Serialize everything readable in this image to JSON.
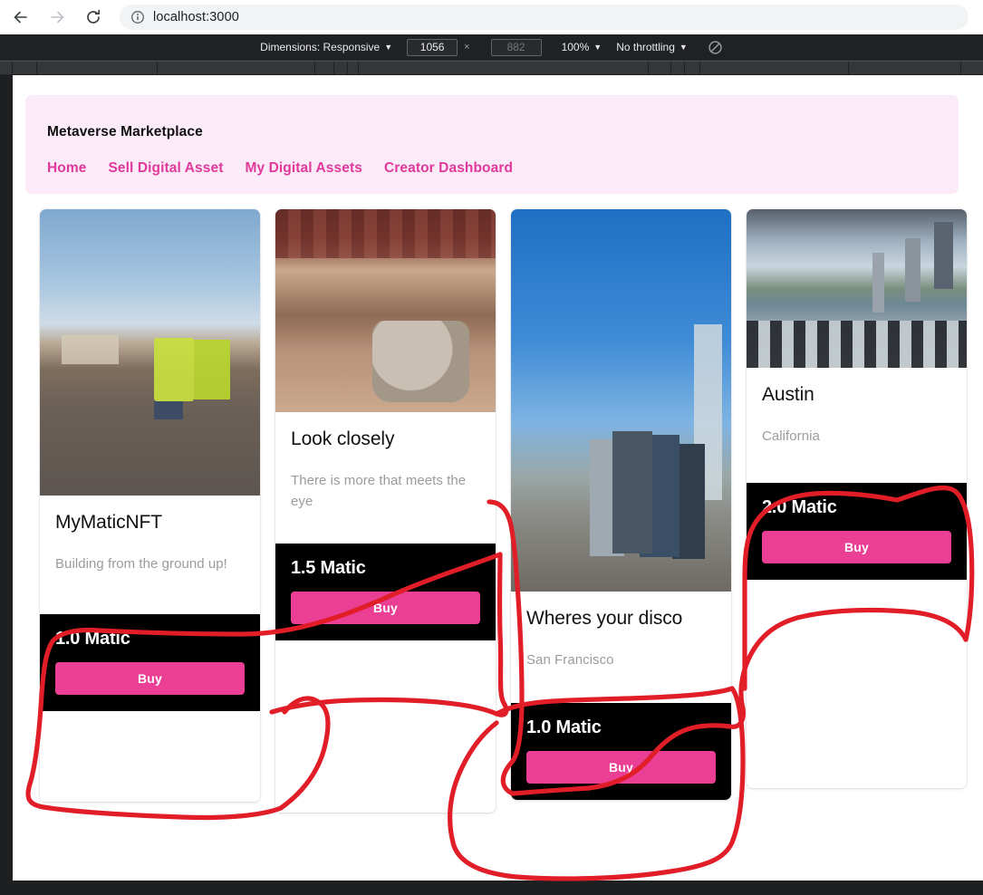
{
  "browser": {
    "back_icon": "back-arrow-icon",
    "forward_icon": "forward-arrow-icon",
    "reload_icon": "reload-icon",
    "site_info_icon": "info-circle-icon",
    "url": "localhost:3000"
  },
  "devtools": {
    "dimensions_label": "Dimensions: Responsive",
    "width_value": "1056",
    "height_placeholder": "882",
    "height_value": "",
    "multiply_symbol": "×",
    "zoom_label": "100%",
    "throttling_label": "No throttling",
    "rotate_icon": "no-throttle-slash-icon",
    "caret": "▼"
  },
  "header": {
    "brand": "Metaverse Marketplace",
    "nav": [
      {
        "label": "Home"
      },
      {
        "label": "Sell Digital Asset"
      },
      {
        "label": "My Digital Assets"
      },
      {
        "label": "Creator Dashboard"
      }
    ]
  },
  "cards": [
    {
      "title": "MyMaticNFT",
      "description": "Building from the ground up!",
      "price": "1.0 Matic",
      "buy_label": "Buy",
      "image_name": "construction-site-photo"
    },
    {
      "title": "Look closely",
      "description": "There is more that meets the eye",
      "price": "1.5 Matic",
      "buy_label": "Buy",
      "image_name": "vintage-diner-car-painting"
    },
    {
      "title": "Wheres your disco",
      "description": "San Francisco",
      "price": "1.0 Matic",
      "buy_label": "Buy",
      "image_name": "san-francisco-skyline-photo"
    },
    {
      "title": "Austin",
      "description": "California",
      "price": "2.0 Matic",
      "buy_label": "Buy",
      "image_name": "austin-skyline-photo"
    }
  ],
  "colors": {
    "accent_pink": "#ea3f95",
    "header_bg": "#fbeaf7",
    "card_footer_bg": "#000000",
    "annotation_red": "#e11d28",
    "devtools_bg": "#202124"
  },
  "annotation": {
    "name": "red-ink-circles",
    "stroke_color": "#e11d28",
    "description": "Hand-drawn red circles around the price/Buy footers"
  }
}
